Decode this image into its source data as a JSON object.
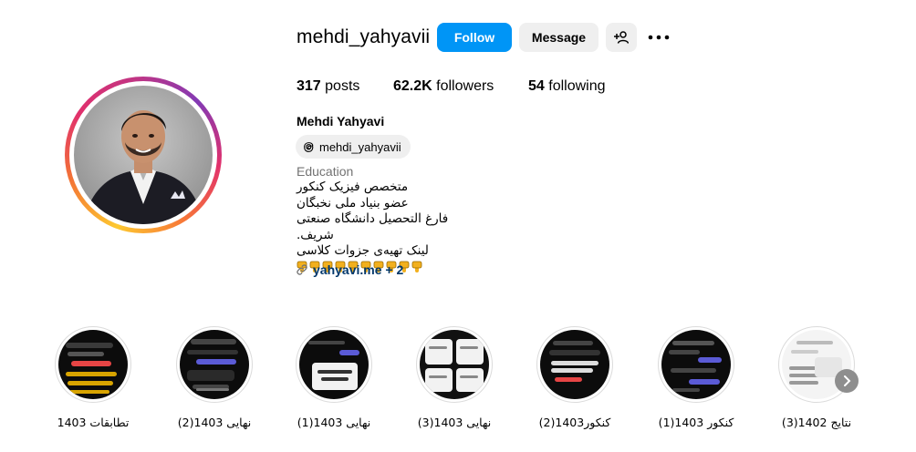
{
  "profile": {
    "username": "mehdi_yahyavii",
    "full_name": "Mehdi Yahyavi",
    "threads_handle": "mehdi_yahyavii",
    "category": "Education",
    "bio_lines": [
      "متخصص فیزیک کنکور",
      "عضو بنیاد ملی نخبگان",
      "فارغ التحصیل دانشگاه صنعتی شریف.",
      "لینک تهیه‌ی جزوات کلاسی"
    ],
    "link_text": "yahyavi.me + 2"
  },
  "actions": {
    "follow_label": "Follow",
    "message_label": "Message"
  },
  "stats": {
    "posts_count": "317",
    "posts_label": "posts",
    "followers_count": "62.2K",
    "followers_label": "followers",
    "following_count": "54",
    "following_label": "following"
  },
  "highlights": [
    {
      "label": "تطابقات 1403",
      "theme": "dark-yellow"
    },
    {
      "label": "نهایی 1403(2)",
      "theme": "dark"
    },
    {
      "label": "نهایی 1403(1)",
      "theme": "dark-card"
    },
    {
      "label": "نهایی 1403(3)",
      "theme": "light-grid"
    },
    {
      "label": "کنکور1403(2)",
      "theme": "dark"
    },
    {
      "label": "کنکور 1403(1)",
      "theme": "dark-blue"
    },
    {
      "label": "نتایج 1402(3)",
      "theme": "light"
    }
  ],
  "icons": {
    "add_user": "add-user-icon",
    "more": "more-icon",
    "threads": "threads-icon",
    "link": "link-icon",
    "next": "chevron-right-icon",
    "emoji": "point-down-emoji"
  },
  "colors": {
    "follow_blue": "#0095f6",
    "secondary_button": "#efefef",
    "link_color": "#00376b",
    "muted_text": "#737373"
  }
}
